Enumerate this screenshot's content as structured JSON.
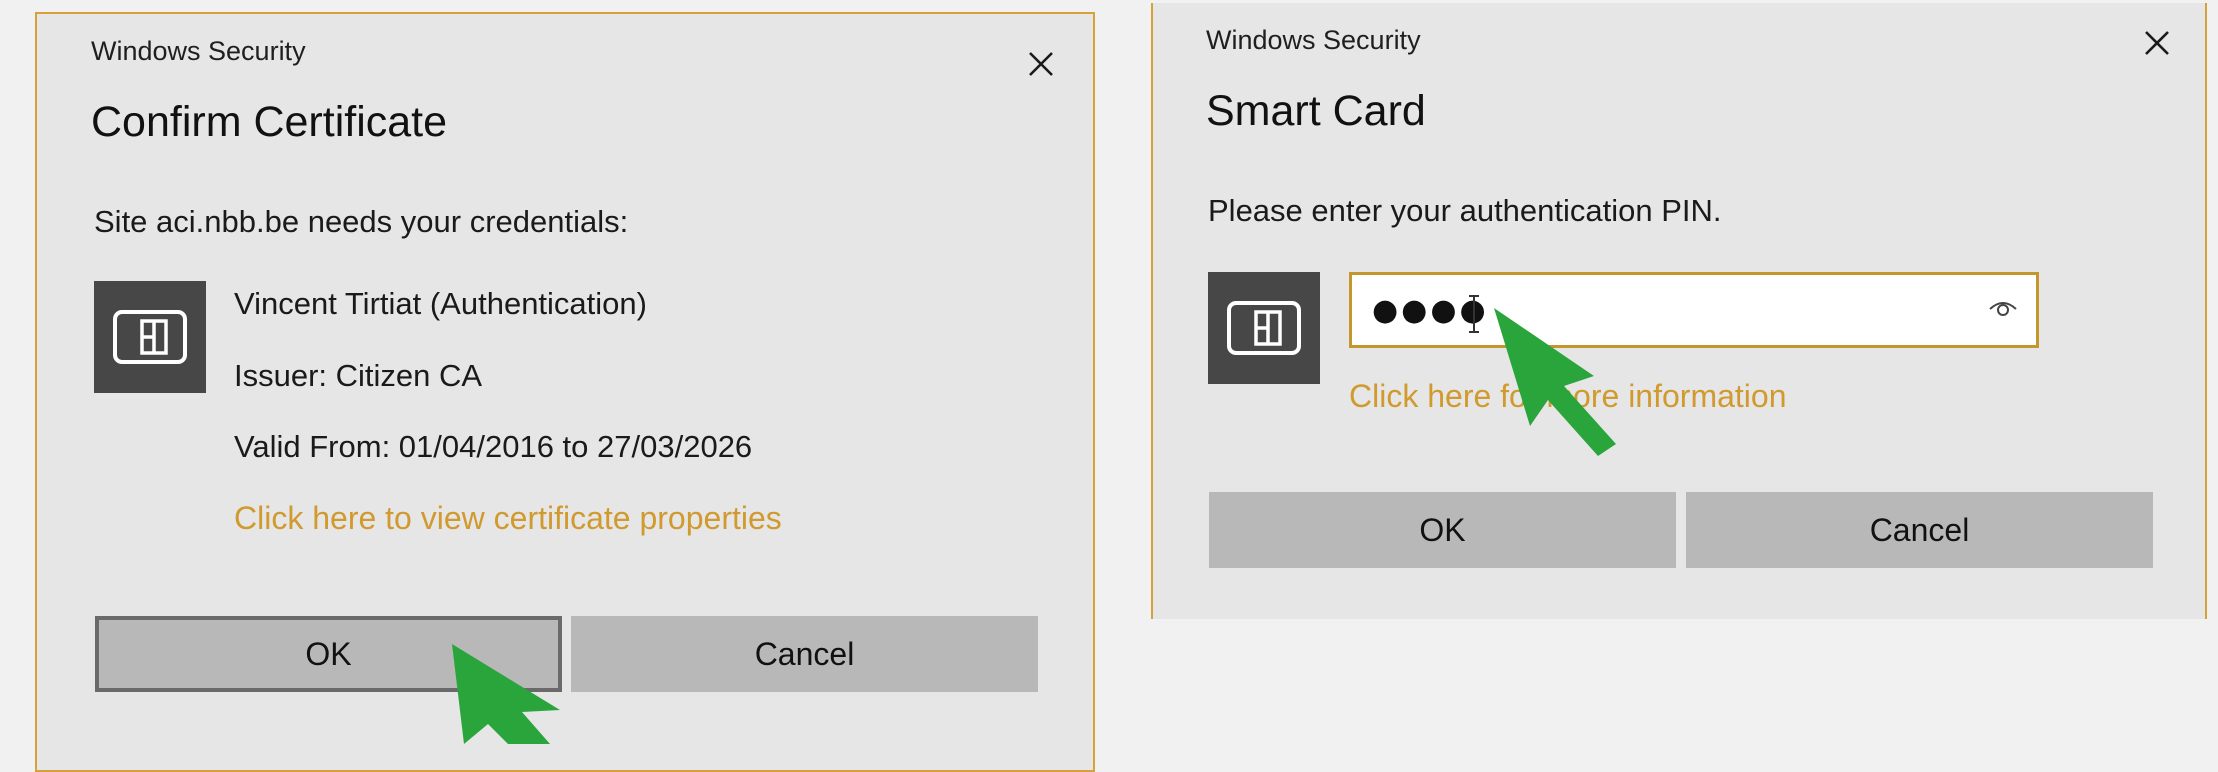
{
  "dialog_left": {
    "app_title": "Windows Security",
    "heading": "Confirm Certificate",
    "message": "Site aci.nbb.be needs your credentials:",
    "certificate": {
      "subject": "Vincent Tirtiat (Authentication)",
      "issuer": "Issuer: Citizen CA",
      "valid": "Valid From: 01/04/2016 to 27/03/2026"
    },
    "link": "Click here to view certificate properties",
    "ok_label": "OK",
    "cancel_label": "Cancel"
  },
  "dialog_right": {
    "app_title": "Windows Security",
    "heading": "Smart Card",
    "message": "Please enter your authentication PIN.",
    "pin_value": "●●●●",
    "link": "Click here for more information",
    "ok_label": "OK",
    "cancel_label": "Cancel"
  },
  "icons": {
    "close": "close-icon",
    "smart_card": "smart-card-icon",
    "reveal": "eye-icon",
    "pointer": "arrow-pointer-icon"
  },
  "colors": {
    "accent": "#d6a13b",
    "link": "#d19a2e",
    "dialog_bg": "#e6e6e6",
    "button_bg": "#b8b8b8",
    "card_tile": "#474747",
    "pointer": "#2aa53b"
  }
}
